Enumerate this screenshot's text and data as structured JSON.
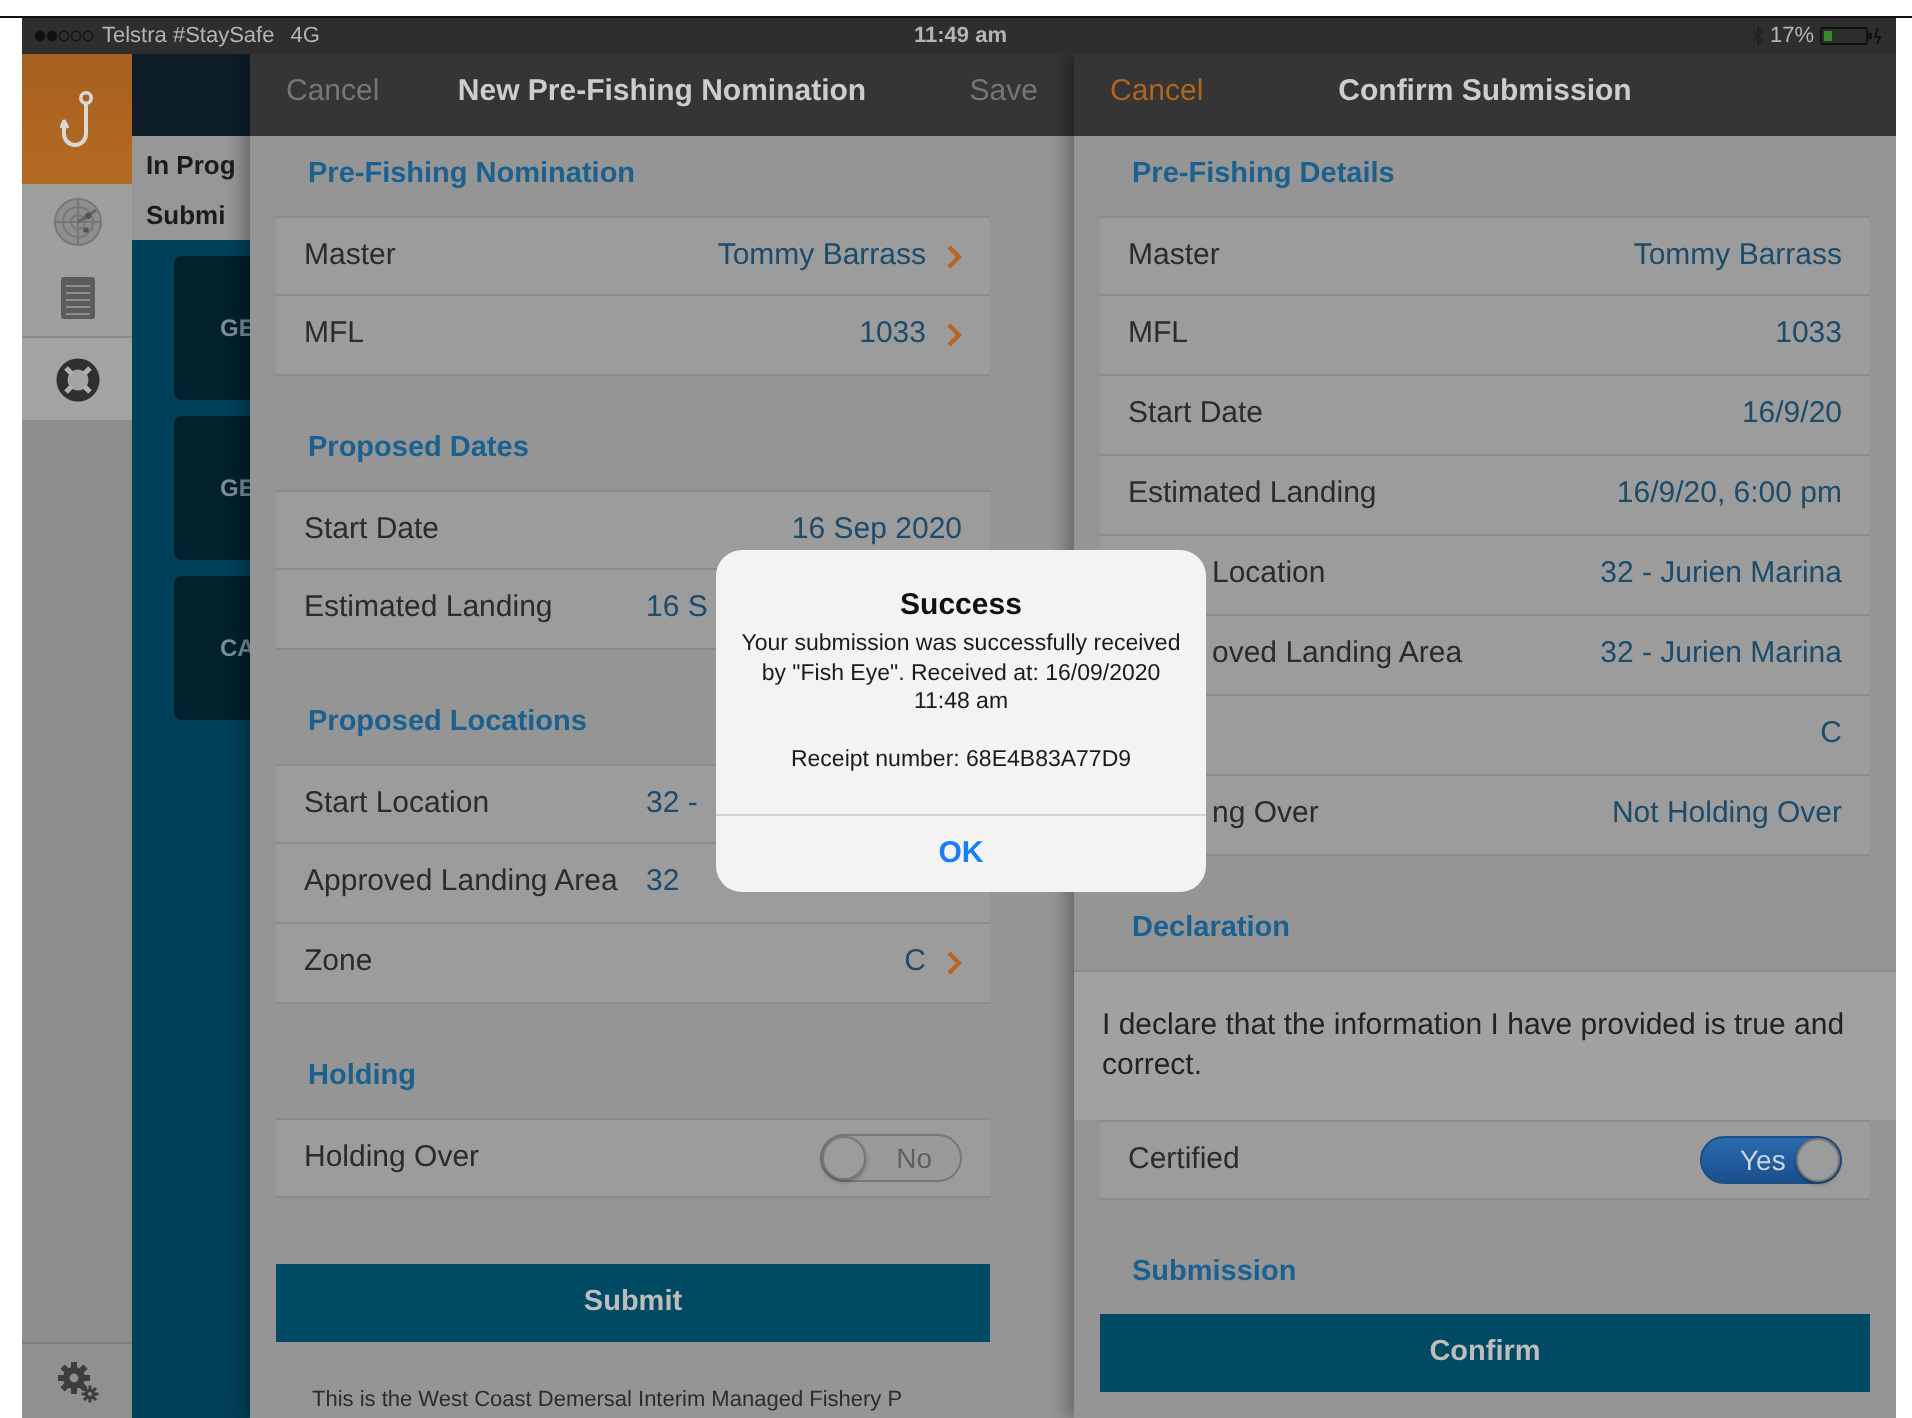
{
  "status_bar": {
    "carrier": "Telstra #StaySafe",
    "network": "4G",
    "time": "11:49 am",
    "battery": "17%"
  },
  "background_list": {
    "items": [
      {
        "label": "In Prog"
      },
      {
        "label": "Submi"
      }
    ],
    "cards": [
      {
        "label": "GE"
      },
      {
        "label": "GE"
      },
      {
        "label": "CA"
      }
    ]
  },
  "nomination": {
    "nav": {
      "cancel": {
        "label": "Cancel",
        "enabled": false
      },
      "title": "New Pre-Fishing Nomination",
      "save": {
        "label": "Save",
        "enabled": false
      }
    },
    "sections": [
      {
        "title": "Pre-Fishing Nomination",
        "rows": [
          {
            "kind": "value",
            "label": "Master",
            "value": "Tommy Barrass",
            "disclosure": true
          },
          {
            "kind": "value",
            "label": "MFL",
            "value": "1033",
            "disclosure": true
          }
        ]
      },
      {
        "title": "Proposed Dates",
        "rows": [
          {
            "kind": "value",
            "label": "Start Date",
            "value": "16 Sep 2020",
            "disclosure": false
          },
          {
            "kind": "partial_value",
            "label": "Estimated Landing",
            "value": "16 S",
            "disclosure": false
          }
        ]
      },
      {
        "title": "Proposed Locations",
        "rows": [
          {
            "kind": "partial_value",
            "label": "Start Location",
            "value": "32 -",
            "disclosure": false
          },
          {
            "kind": "partial_value",
            "label": "Approved Landing Area",
            "value": "32",
            "disclosure": false
          },
          {
            "kind": "value",
            "label": "Zone",
            "value": "C",
            "disclosure": true
          }
        ]
      },
      {
        "title": "Holding",
        "rows": [
          {
            "kind": "switch",
            "label": "Holding Over",
            "on": false,
            "text": "No"
          }
        ]
      }
    ],
    "button": "Submit",
    "footer": "This is the West Coast Demersal Interim Managed Fishery P"
  },
  "confirm": {
    "nav": {
      "cancel": {
        "label": "Cancel",
        "enabled": true
      },
      "title": "Confirm Submission"
    },
    "sections": [
      {
        "title": "Pre-Fishing Details",
        "rows": [
          {
            "kind": "value",
            "label": "Master",
            "value": "Tommy Barrass",
            "disclosure": false
          },
          {
            "kind": "value",
            "label": "MFL",
            "value": "1033",
            "disclosure": false
          },
          {
            "kind": "value",
            "label": "Start Date",
            "value": "16/9/20",
            "disclosure": false
          },
          {
            "kind": "value",
            "label": "Estimated Landing",
            "value": "16/9/20, 6:00 pm",
            "disclosure": false
          },
          {
            "kind": "partial_label",
            "label": "Location",
            "value": "32 - Jurien Marina",
            "disclosure": false
          },
          {
            "kind": "partial_label",
            "label": "oved Landing Area",
            "value": "32 - Jurien Marina",
            "disclosure": false
          },
          {
            "kind": "value",
            "value": "C",
            "disclosure": false
          },
          {
            "kind": "partial_label",
            "label": "ng Over",
            "value": "Not Holding Over",
            "disclosure": false
          }
        ]
      },
      {
        "title": "Declaration",
        "text": "I declare that the information I have provided is true and correct.",
        "rows": [
          {
            "kind": "switch",
            "label": "Certified",
            "on": true,
            "text": "Yes"
          }
        ]
      },
      {
        "title": "Submission"
      }
    ],
    "button": "Confirm"
  },
  "alert": {
    "title": "Success",
    "message": [
      "Your submission was successfully received by \"Fish Eye\". Received at: 16/09/2020 11:48 am",
      "Receipt number: 68E4B83A77D9"
    ],
    "button": "OK"
  }
}
